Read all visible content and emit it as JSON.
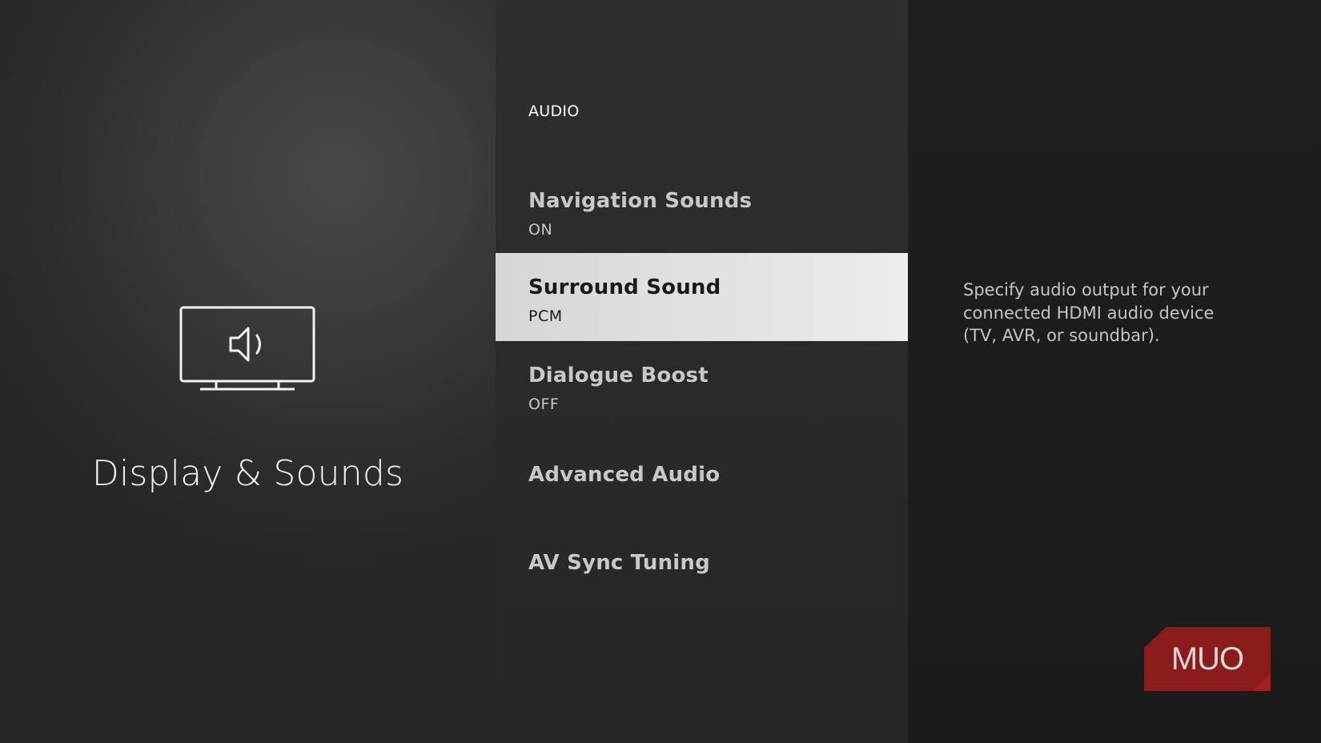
{
  "category": {
    "title": "Display & Sounds",
    "icon": "tv-speaker-icon"
  },
  "section": {
    "header": "AUDIO"
  },
  "menu": {
    "items": [
      {
        "label": "Navigation Sounds",
        "value": "ON",
        "selected": false
      },
      {
        "label": "Surround Sound",
        "value": "PCM",
        "selected": true
      },
      {
        "label": "Dialogue Boost",
        "value": "OFF",
        "selected": false
      },
      {
        "label": "Advanced Audio",
        "value": "",
        "selected": false
      },
      {
        "label": "AV Sync Tuning",
        "value": "",
        "selected": false
      }
    ]
  },
  "description": {
    "line1": "Specify audio output for your",
    "line2": "connected HDMI audio device",
    "line3": "(TV, AVR, or soundbar)."
  },
  "watermark": {
    "text": "MUO",
    "color": "#8b1a1a"
  },
  "colors": {
    "selected_bg": "#e3e3e3",
    "text_primary": "#ffffff",
    "text_secondary": "#c8c8c8"
  }
}
